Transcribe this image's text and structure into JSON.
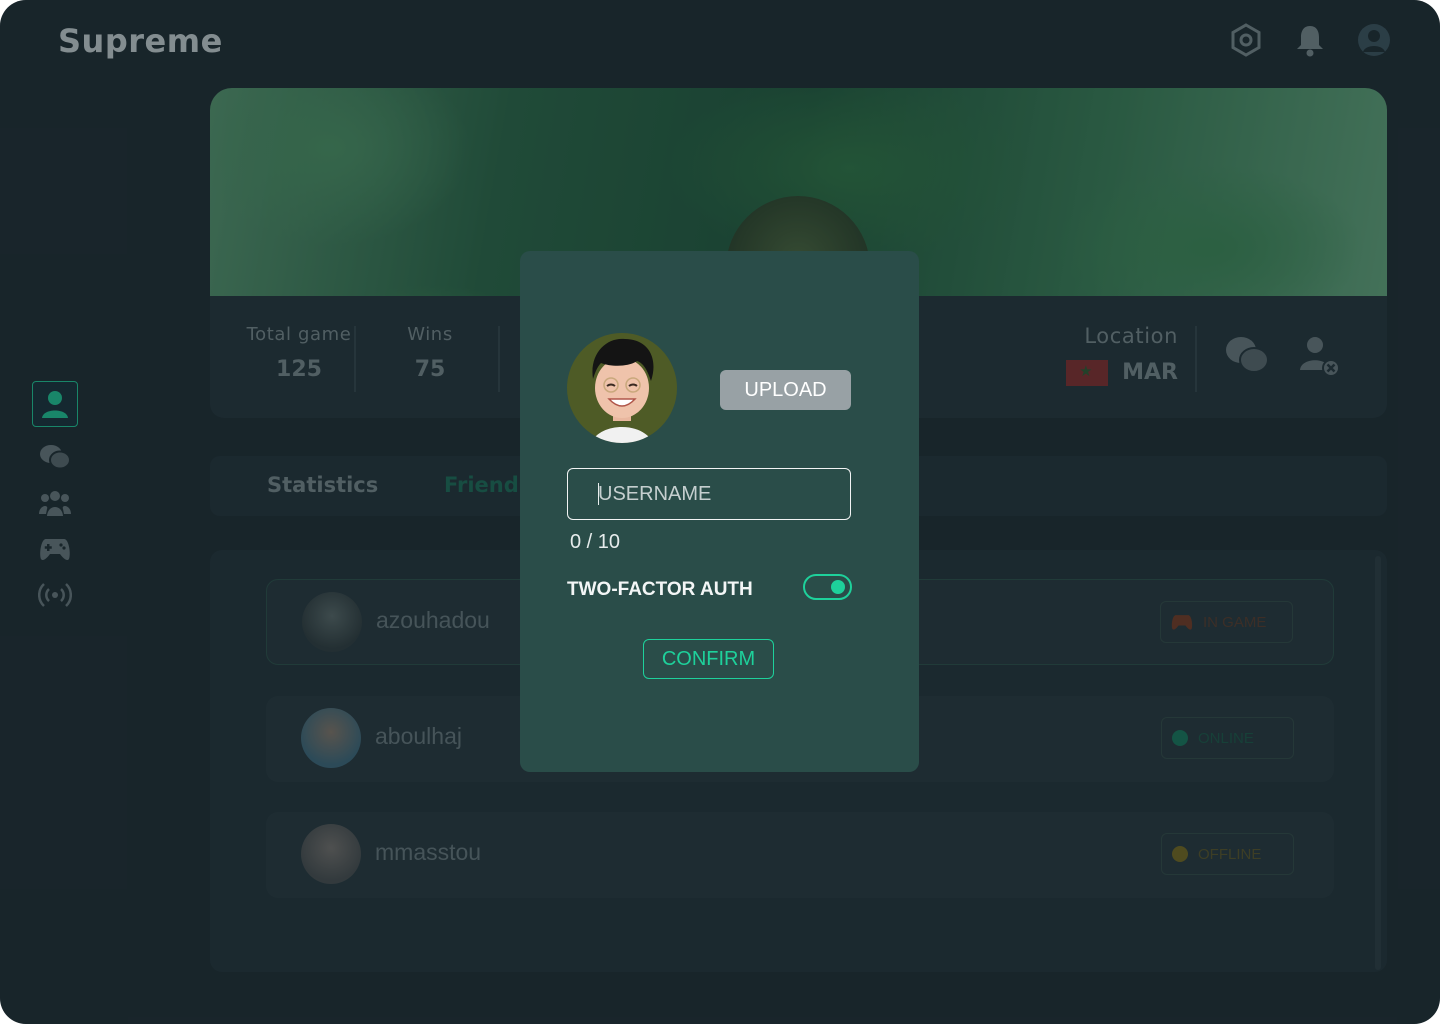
{
  "app": {
    "brand": "Supreme"
  },
  "header": {
    "icons": [
      "settings-icon",
      "notification-bell-icon",
      "profile-avatar-icon"
    ]
  },
  "sidebar": {
    "items": [
      {
        "icon": "user-icon",
        "active": true
      },
      {
        "icon": "chat-icon",
        "active": false
      },
      {
        "icon": "friends-icon",
        "active": false
      },
      {
        "icon": "gamepad-icon",
        "active": false
      },
      {
        "icon": "broadcast-icon",
        "active": false
      }
    ]
  },
  "stats": {
    "total_game_label": "Total game",
    "total_game_value": "125",
    "wins_label": "Wins",
    "wins_value": "75",
    "location_label": "Location",
    "location_value": "MAR"
  },
  "tabs": {
    "statistics": "Statistics",
    "friends": "Friends"
  },
  "friends": [
    {
      "name": "azouhadou",
      "status": "IN GAME",
      "status_color": "#e36b3a"
    },
    {
      "name": "aboulhaj",
      "status": "ONLINE",
      "status_color": "#1ed19b"
    },
    {
      "name": "mmasstou",
      "status": "OFFLINE",
      "status_color": "#e6c530"
    }
  ],
  "modal": {
    "upload_label": "UPLOAD",
    "username_placeholder": "USERNAME",
    "username_value": "",
    "counter": "0 / 10",
    "two_factor_label": "TWO-FACTOR AUTH",
    "two_factor_enabled": true,
    "confirm_label": "CONFIRM"
  },
  "colors": {
    "accent": "#1ed19b",
    "background": "#1d2a30",
    "modal_bg": "#2a4d49"
  }
}
